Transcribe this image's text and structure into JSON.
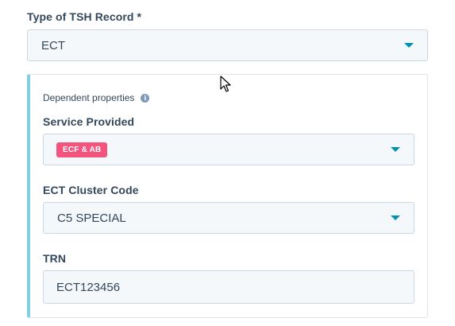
{
  "tsh_record": {
    "label": "Type of TSH Record *",
    "value": "ECT"
  },
  "dependent": {
    "title": "Dependent properties",
    "info_icon": "info-icon",
    "service_provided": {
      "label": "Service Provided",
      "tag": "ECF & AB"
    },
    "ect_cluster_code": {
      "label": "ECT Cluster Code",
      "value": "C5 SPECIAL"
    },
    "trn": {
      "label": "TRN",
      "value": "ECT123456"
    }
  },
  "colors": {
    "accent": "#0091ae",
    "tag": "#f2547d",
    "card_border": "#7fd1de"
  }
}
